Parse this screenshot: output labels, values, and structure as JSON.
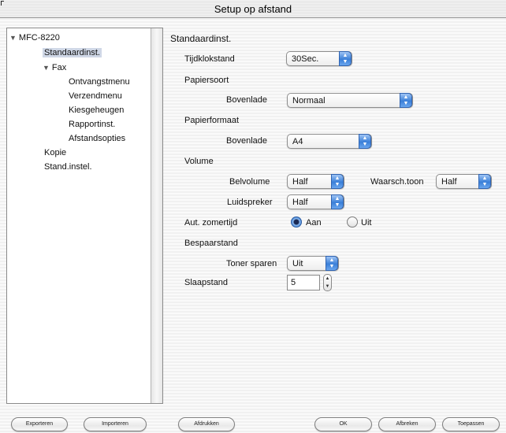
{
  "window": {
    "title": "Setup op afstand"
  },
  "tree": {
    "root": "MFC-8220",
    "items": [
      {
        "label": "Standaardinst.",
        "selected": true
      },
      {
        "label": "Fax"
      },
      {
        "label": "Ontvangstmenu"
      },
      {
        "label": "Verzendmenu"
      },
      {
        "label": "Kiesgeheugen"
      },
      {
        "label": "Rapportinst."
      },
      {
        "label": "Afstandsopties"
      },
      {
        "label": "Kopie"
      },
      {
        "label": "Stand.instel."
      }
    ]
  },
  "panel": {
    "heading": "Standaardinst.",
    "tijdklokstand": {
      "label": "Tijdklokstand",
      "value": "30Sec."
    },
    "papiersoort": {
      "label": "Papiersoort",
      "tray_label": "Bovenlade",
      "value": "Normaal"
    },
    "papierformaat": {
      "label": "Papierformaat",
      "tray_label": "Bovenlade",
      "value": "A4"
    },
    "volume": {
      "label": "Volume",
      "belvolume_label": "Belvolume",
      "belvolume_value": "Half",
      "waarsch_label": "Waarsch.toon",
      "waarsch_value": "Half",
      "luidspreker_label": "Luidspreker",
      "luidspreker_value": "Half"
    },
    "zomertijd": {
      "label": "Aut. zomertijd",
      "on_label": "Aan",
      "off_label": "Uit",
      "selected": "Aan"
    },
    "bespaarstand": {
      "label": "Bespaarstand",
      "toner_label": "Toner sparen",
      "toner_value": "Uit"
    },
    "slaapstand": {
      "label": "Slaapstand",
      "value": "5"
    }
  },
  "buttons": {
    "exporteren": "Exporteren",
    "importeren": "Importeren",
    "afdrukken": "Afdrukken",
    "ok": "OK",
    "afbreken": "Afbreken",
    "toepassen": "Toepassen"
  },
  "colors": {
    "popup_arrow": "#3a7fd8",
    "selected_row": "#cfd7e6",
    "radio_on": "#3f7fd2"
  },
  "icons": {
    "tree_expanded": "triangle-down-icon",
    "popup_arrow": "updown-arrows-icon",
    "stepper": "stepper-arrows-icon"
  }
}
